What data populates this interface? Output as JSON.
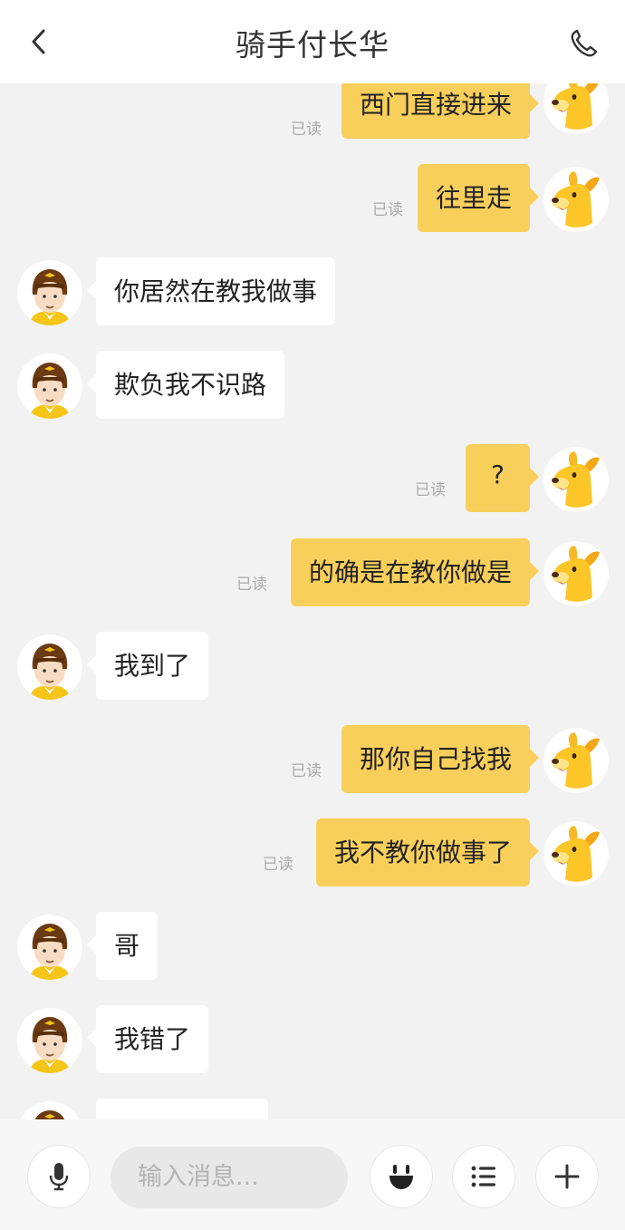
{
  "header": {
    "title": "骑手付长华",
    "back_icon": "chevron-left-icon",
    "call_icon": "phone-icon"
  },
  "messages": [
    {
      "side": "right",
      "text": "西门直接进来",
      "status": "已读"
    },
    {
      "side": "right",
      "text": "往里走",
      "status": "已读"
    },
    {
      "side": "left",
      "text": "你居然在教我做事"
    },
    {
      "side": "left",
      "text": "欺负我不识路"
    },
    {
      "side": "right",
      "text": "?",
      "status": "已读"
    },
    {
      "side": "right",
      "text": "的确是在教你做是",
      "status": "已读"
    },
    {
      "side": "left",
      "text": "我到了"
    },
    {
      "side": "right",
      "text": "那你自己找我",
      "status": "已读"
    },
    {
      "side": "right",
      "text": "我不教你做事了",
      "status": "已读"
    },
    {
      "side": "left",
      "text": "哥"
    },
    {
      "side": "left",
      "text": "我错了"
    },
    {
      "side": "left",
      "text": ""
    }
  ],
  "composer": {
    "placeholder": "输入消息...",
    "voice_icon": "microphone-icon",
    "emoji_icon": "smiley-icon",
    "menu_icon": "list-icon",
    "add_icon": "plus-icon"
  },
  "colors": {
    "own_bubble": "#f9cf5b",
    "other_bubble": "#ffffff",
    "background": "#f2f2f2"
  }
}
